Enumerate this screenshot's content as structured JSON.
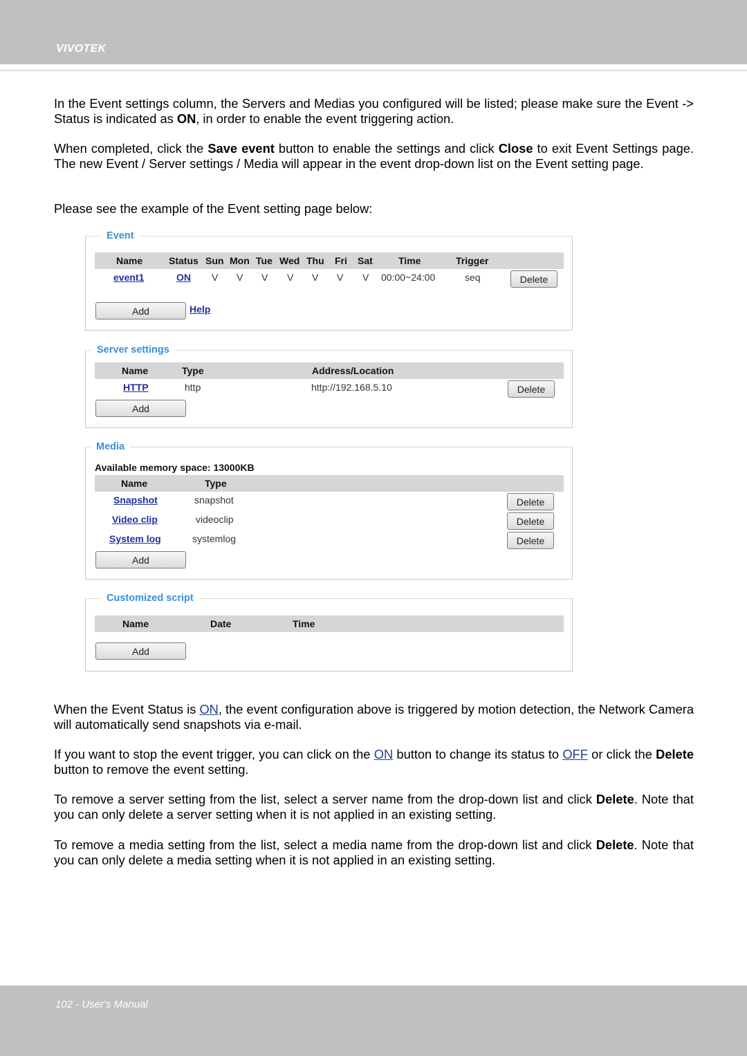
{
  "header": {
    "brand": "VIVOTEK"
  },
  "intro": {
    "p1_a": "In the Event settings column, the Servers and Medias you configured will be listed; please make sure the Event -> Status is indicated as ",
    "p1_b": "ON",
    "p1_c": ", in order to enable the event triggering action.",
    "p2_a": "When completed, click the ",
    "p2_b": "Save event",
    "p2_c": " button to enable the settings and click ",
    "p2_d": "Close",
    "p2_e": " to exit Event Settings page. The new Event / Server settings / Media will appear in the event drop-down list on the Event setting page.",
    "p3": "Please see the example of the Event setting page below:"
  },
  "event_panel": {
    "legend": "Event",
    "columns": [
      "Name",
      "Status",
      "Sun",
      "Mon",
      "Tue",
      "Wed",
      "Thu",
      "Fri",
      "Sat",
      "Time",
      "Trigger"
    ],
    "row": {
      "name": "event1",
      "status": "ON",
      "days": [
        "V",
        "V",
        "V",
        "V",
        "V",
        "V",
        "V"
      ],
      "time": "00:00~24:00",
      "trigger": "seq"
    },
    "delete_label": "Delete",
    "add_label": "Add",
    "help_label": "Help"
  },
  "server_panel": {
    "legend": "Server settings",
    "columns": [
      "Name",
      "Type",
      "Address/Location"
    ],
    "row": {
      "name": "HTTP",
      "type": "http",
      "address": "http://192.168.5.10"
    },
    "delete_label": "Delete",
    "add_label": "Add"
  },
  "media_panel": {
    "legend": "Media",
    "memory": "Available memory space: 13000KB",
    "columns": [
      "Name",
      "Type"
    ],
    "rows": [
      {
        "name": "Snapshot",
        "type": "snapshot"
      },
      {
        "name": "Video clip",
        "type": "videoclip"
      },
      {
        "name": "System log",
        "type": "systemlog"
      }
    ],
    "delete_label": "Delete",
    "add_label": "Add"
  },
  "script_panel": {
    "legend": "Customized script",
    "columns": [
      "Name",
      "Date",
      "Time"
    ],
    "add_label": "Add"
  },
  "notes": {
    "n1_a": "When the Event Status is ",
    "n1_b": "ON",
    "n1_c": ", the event configuration above is triggered by motion detection, the Network Camera will  automatically send snapshots via e-mail.",
    "n2_a": "If you want to stop the event trigger, you can click on the ",
    "n2_b": "ON",
    "n2_c": " button to change its status to ",
    "n2_d": "OFF",
    "n2_e": " or click the ",
    "n2_f": "Delete",
    "n2_g": " button to remove the event setting.",
    "n3_a": "To remove a server setting from the list, select a server name from the drop-down list and click ",
    "n3_b": "Delete",
    "n3_c": ". Note that you can only delete a server setting when it is not applied in an existing setting.",
    "n4_a": "To remove a media setting from the list, select a media name from the drop-down list and click ",
    "n4_b": "Delete",
    "n4_c": ". Note that you can only delete a media setting when it is not applied in an existing setting."
  },
  "footer": {
    "page_label": "102 - User's Manual"
  }
}
